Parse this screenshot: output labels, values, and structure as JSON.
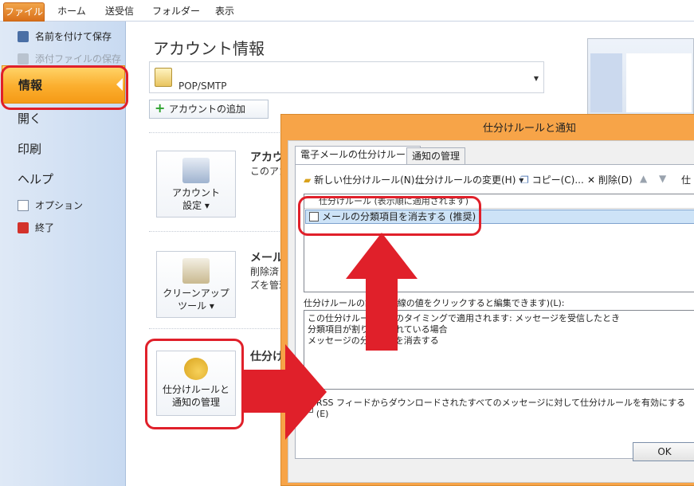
{
  "ribbon": {
    "tabs": [
      "ファイル",
      "ホーム",
      "送受信",
      "フォルダー",
      "表示"
    ]
  },
  "backstage": {
    "items_small": [
      "名前を付けて保存",
      "添付ファイルの保存"
    ],
    "selected": "情報",
    "items_large": [
      "開く",
      "印刷",
      "ヘルプ"
    ],
    "options": "オプション",
    "exit": "終了"
  },
  "main": {
    "title": "アカウント情報",
    "account": "POP/SMTP",
    "add_account": "アカウントの追加",
    "account_settings": {
      "line1": "アカウント",
      "line2": "設定 ▾",
      "title": "アカウ",
      "text": "このアカ"
    },
    "cleanup": {
      "line1": "クリーンアップ",
      "line2": "ツール ▾",
      "title": "メール",
      "text1": "削除済",
      "text2": "ズを管理"
    },
    "rules": {
      "line1": "仕分けルールと",
      "line2": "通知の管理",
      "title": "仕分け"
    }
  },
  "dialog": {
    "title": "仕分けルールと通知",
    "tabs": [
      "電子メールの仕分けルール",
      "通知の管理"
    ],
    "toolbar": {
      "new_rule": "新しい仕分けルール(N)...",
      "change_rule": "仕分けルールの変更(H) ▾",
      "copy": "コピー(C)...",
      "delete": "削除(D)",
      "more": "仕"
    },
    "list_header": "仕分けルール (表示順に適用されます)",
    "rule": "メールの分類項目を消去する (推奨)",
    "description_label": "仕分けルールの説明 (下線の値をクリックすると編集できます)(L):",
    "description_lines": [
      "この仕分けルールは次のタイミングで適用されます: メッセージを受信したとき",
      "分類項目が割り当てられている場合",
      "メッセージの分類項目を消去する"
    ],
    "rss": "RSS フィードからダウンロードされたすべてのメッセージに対して仕分けルールを有効にする(E)",
    "ok": "OK"
  },
  "colors": {
    "annotation_red": "#e0202a",
    "accent_orange": "#f7a448"
  }
}
